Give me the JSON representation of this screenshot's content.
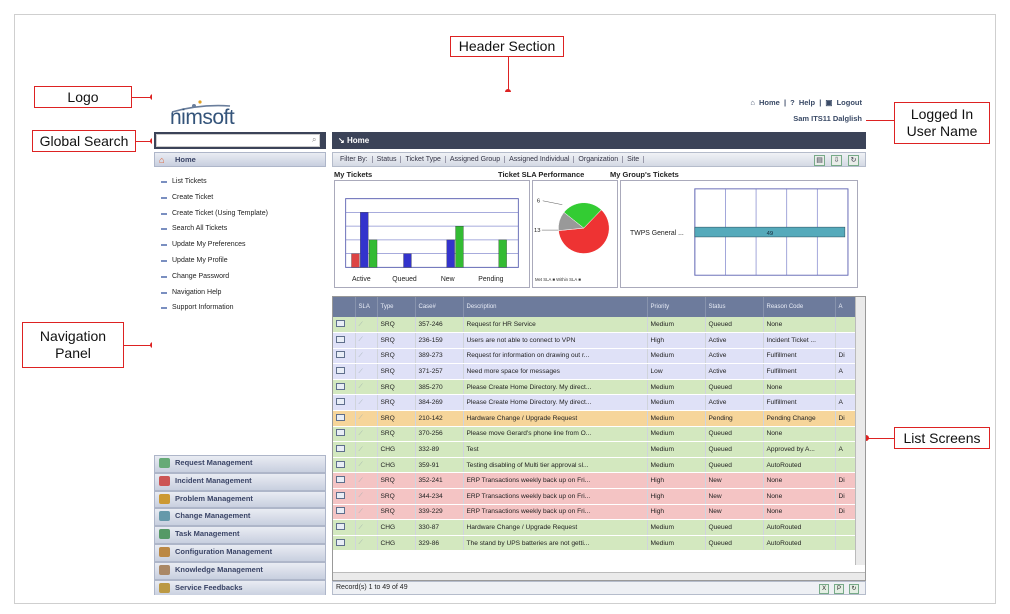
{
  "annotations": {
    "header": "Header Section",
    "logo": "Logo",
    "global_search": "Global Search",
    "navigation_panel_line1": "Navigation",
    "navigation_panel_line2": "Panel",
    "logged_in_line1": "Logged In",
    "logged_in_line2": "User Name",
    "list_screens": "List Screens"
  },
  "app": {
    "logo_text": "nimsoft",
    "top_links": {
      "home": "Home",
      "help": "Help",
      "logout": "Logout"
    },
    "user_name": "Sam ITS11 Dalglish",
    "search_placeholder": "",
    "breadcrumb": "Home"
  },
  "nav": {
    "home_header": "Home",
    "links": [
      "List Tickets",
      "Create Ticket",
      "Create Ticket (Using Template)",
      "Search All Tickets",
      "Update My Preferences",
      "Update My Profile",
      "Change Password",
      "Navigation Help",
      "Support Information"
    ],
    "modules": [
      {
        "label": "Request Management",
        "icon": "request-icon",
        "color": "#6a7"
      },
      {
        "label": "Incident Management",
        "icon": "incident-icon",
        "color": "#c55"
      },
      {
        "label": "Problem Management",
        "icon": "problem-icon",
        "color": "#c93"
      },
      {
        "label": "Change Management",
        "icon": "change-icon",
        "color": "#69a"
      },
      {
        "label": "Task Management",
        "icon": "task-icon",
        "color": "#596"
      },
      {
        "label": "Configuration Management",
        "icon": "config-icon",
        "color": "#b84"
      },
      {
        "label": "Knowledge Management",
        "icon": "knowledge-icon",
        "color": "#a86"
      },
      {
        "label": "Service Feedbacks",
        "icon": "feedback-icon",
        "color": "#b94"
      }
    ]
  },
  "filter": {
    "items": [
      "Filter By:",
      "Status",
      "Ticket Type",
      "Assigned Group",
      "Assigned Individual",
      "Organization",
      "Site"
    ]
  },
  "chart_data": [
    {
      "type": "bar",
      "title": "My Tickets",
      "categories": [
        "Active",
        "Queued",
        "New",
        "Pending"
      ],
      "series": [
        {
          "values": [
            1,
            0,
            0,
            0
          ],
          "color": "#d44"
        },
        {
          "values": [
            4,
            1,
            2,
            0
          ],
          "color": "#33c"
        },
        {
          "values": [
            2,
            0,
            3,
            2
          ],
          "color": "#3b3"
        }
      ],
      "labels": [
        "",
        "",
        "",
        ""
      ]
    },
    {
      "type": "pie",
      "title": "Ticket SLA Performance",
      "slices": [
        {
          "name": "Met SLA",
          "value": 0,
          "color": "#aaa"
        },
        {
          "name": "Within SLA",
          "value": 13,
          "color": "#3c3"
        },
        {
          "name": "",
          "value": 30,
          "color": "#e33"
        },
        {
          "name": "",
          "value": 6,
          "color": "#999"
        }
      ],
      "point_labels": [
        "6",
        "13"
      ],
      "legend": [
        "Met SLA",
        "Within SLA"
      ]
    },
    {
      "type": "bar",
      "title": "My Group's Tickets",
      "orientation": "horizontal",
      "categories": [
        "TWPS General ..."
      ],
      "values": [
        49
      ],
      "color": "#5ab"
    }
  ],
  "table": {
    "columns": [
      "",
      "SLA",
      "Type",
      "Case#",
      "Description",
      "Priority",
      "Status",
      "Reason Code",
      "A"
    ],
    "rows": [
      {
        "type": "SRQ",
        "case": "357-246",
        "desc": "Request for HR Service",
        "priority": "Medium",
        "status": "Queued",
        "reason": "None",
        "a": "",
        "color": "g"
      },
      {
        "type": "SRQ",
        "case": "236-159",
        "desc": "Users are not able to connect to VPN",
        "priority": "High",
        "status": "Active",
        "reason": "Incident Ticket ...",
        "a": "",
        "color": "b"
      },
      {
        "type": "SRQ",
        "case": "389-273",
        "desc": "Request for information on drawing out r...",
        "priority": "Medium",
        "status": "Active",
        "reason": "Fulfillment",
        "a": "Di",
        "color": "b"
      },
      {
        "type": "SRQ",
        "case": "371-257",
        "desc": "Need more space for messages",
        "priority": "Low",
        "status": "Active",
        "reason": "Fulfillment",
        "a": "A",
        "color": "b"
      },
      {
        "type": "SRQ",
        "case": "385-270",
        "desc": "Please Create Home Directory. My direct...",
        "priority": "Medium",
        "status": "Queued",
        "reason": "None",
        "a": "",
        "color": "g"
      },
      {
        "type": "SRQ",
        "case": "384-269",
        "desc": "Please Create Home Directory. My direct...",
        "priority": "Medium",
        "status": "Active",
        "reason": "Fulfillment",
        "a": "A",
        "color": "b"
      },
      {
        "type": "SRQ",
        "case": "210-142",
        "desc": "Hardware Change / Upgrade Request",
        "priority": "Medium",
        "status": "Pending",
        "reason": "Pending Change",
        "a": "Di",
        "color": "o"
      },
      {
        "type": "SRQ",
        "case": "370-256",
        "desc": "Please move Gerard's phone line from O...",
        "priority": "Medium",
        "status": "Queued",
        "reason": "None",
        "a": "",
        "color": "g"
      },
      {
        "type": "CHG",
        "case": "332-89",
        "desc": "Test",
        "priority": "Medium",
        "status": "Queued",
        "reason": "Approved by A...",
        "a": "A",
        "color": "g"
      },
      {
        "type": "CHG",
        "case": "359-91",
        "desc": "Testing disabling of Multi tier approval sl...",
        "priority": "Medium",
        "status": "Queued",
        "reason": "AutoRouted",
        "a": "",
        "color": "g"
      },
      {
        "type": "SRQ",
        "case": "352-241",
        "desc": "ERP Transactions weekly back up on Fri...",
        "priority": "High",
        "status": "New",
        "reason": "None",
        "a": "Di",
        "color": "r"
      },
      {
        "type": "SRQ",
        "case": "344-234",
        "desc": "ERP Transactions weekly back up on Fri...",
        "priority": "High",
        "status": "New",
        "reason": "None",
        "a": "Di",
        "color": "r"
      },
      {
        "type": "SRQ",
        "case": "339-229",
        "desc": "ERP Transactions weekly back up on Fri...",
        "priority": "High",
        "status": "New",
        "reason": "None",
        "a": "Di",
        "color": "r"
      },
      {
        "type": "CHG",
        "case": "330-87",
        "desc": "Hardware Change / Upgrade Request",
        "priority": "Medium",
        "status": "Queued",
        "reason": "AutoRouted",
        "a": "",
        "color": "g"
      },
      {
        "type": "CHG",
        "case": "329-86",
        "desc": "The stand by UPS batteries are not getti...",
        "priority": "Medium",
        "status": "Queued",
        "reason": "AutoRouted",
        "a": "",
        "color": "g"
      }
    ]
  },
  "footer": {
    "records": "Record(s) 1 to 49 of 49"
  }
}
